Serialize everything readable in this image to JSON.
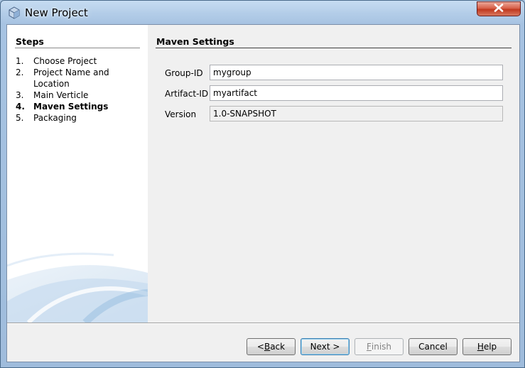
{
  "window": {
    "title": "New Project"
  },
  "steps": {
    "title": "Steps",
    "items": [
      {
        "num": "1.",
        "label": "Choose Project"
      },
      {
        "num": "2.",
        "label": "Project Name and Location"
      },
      {
        "num": "3.",
        "label": "Main Verticle"
      },
      {
        "num": "4.",
        "label": "Maven Settings"
      },
      {
        "num": "5.",
        "label": "Packaging"
      }
    ],
    "active_index": 3
  },
  "content": {
    "title": "Maven Settings",
    "fields": {
      "group_id": {
        "label": "Group-ID",
        "value": "mygroup"
      },
      "artifact_id": {
        "label": "Artifact-ID",
        "value": "myartifact"
      },
      "version": {
        "label": "Version",
        "value": "1.0-SNAPSHOT"
      }
    }
  },
  "buttons": {
    "back": {
      "prefix": "< ",
      "mnemonic": "B",
      "rest": "ack"
    },
    "next": {
      "label": "Next >"
    },
    "finish": {
      "mnemonic": "F",
      "rest": "inish"
    },
    "cancel": {
      "label": "Cancel"
    },
    "help": {
      "mnemonic": "H",
      "rest": "elp"
    }
  },
  "colors": {
    "titlebar": "#a7c3e2",
    "close_button": "#c0391f",
    "panel_background": "#f0f0f0",
    "default_button_border": "#3c7fb1"
  },
  "icons": {
    "app": "netbeans-cube-icon",
    "close": "close-x-icon"
  }
}
